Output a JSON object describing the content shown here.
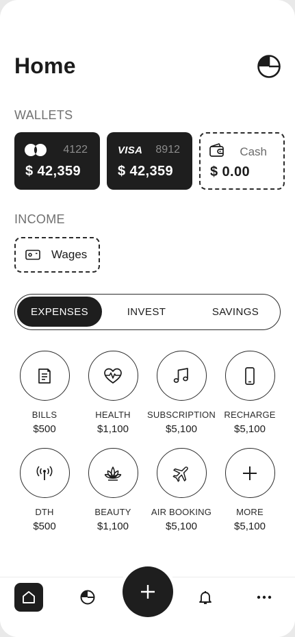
{
  "header": {
    "title": "Home",
    "chart_icon": "pie-chart-icon"
  },
  "wallets": {
    "label": "WALLETS",
    "cards": [
      {
        "brand": "mastercard-logo",
        "number": "4122",
        "amount": "$ 42,359"
      },
      {
        "brand": "VISA",
        "number": "8912",
        "amount": "$ 42,359"
      },
      {
        "brand": "wallet-icon",
        "number": "Cash",
        "amount": "$ 0.00"
      }
    ]
  },
  "income": {
    "label": "INCOME",
    "chip": {
      "icon": "cash-note-icon",
      "label": "Wages"
    }
  },
  "tabs": {
    "expenses": "EXPENSES",
    "invest": "INVEST",
    "savings": "SAVINGS",
    "active": "EXPENSES"
  },
  "categories": [
    {
      "name": "BILLS",
      "value": "$500",
      "icon": "receipt-icon"
    },
    {
      "name": "HEALTH",
      "value": "$1,100",
      "icon": "heart-pulse-icon"
    },
    {
      "name": "SUBSCRIPTION",
      "value": "$5,100",
      "icon": "music-note-icon"
    },
    {
      "name": "RECHARGE",
      "value": "$5,100",
      "icon": "smartphone-icon"
    },
    {
      "name": "DTH",
      "value": "$500",
      "icon": "antenna-icon"
    },
    {
      "name": "BEAUTY",
      "value": "$1,100",
      "icon": "lotus-icon"
    },
    {
      "name": "AIR BOOKING",
      "value": "$5,100",
      "icon": "airplane-icon"
    },
    {
      "name": "MORE",
      "value": "$5,100",
      "icon": "plus-icon"
    }
  ],
  "bottom_nav": {
    "items": [
      "home-icon",
      "pie-chart-icon",
      "add-icon",
      "bell-icon",
      "more-icon"
    ],
    "active": "home-icon"
  },
  "colors": {
    "primary": "#1e1e1e",
    "background": "#ffffff",
    "muted": "#707070"
  }
}
